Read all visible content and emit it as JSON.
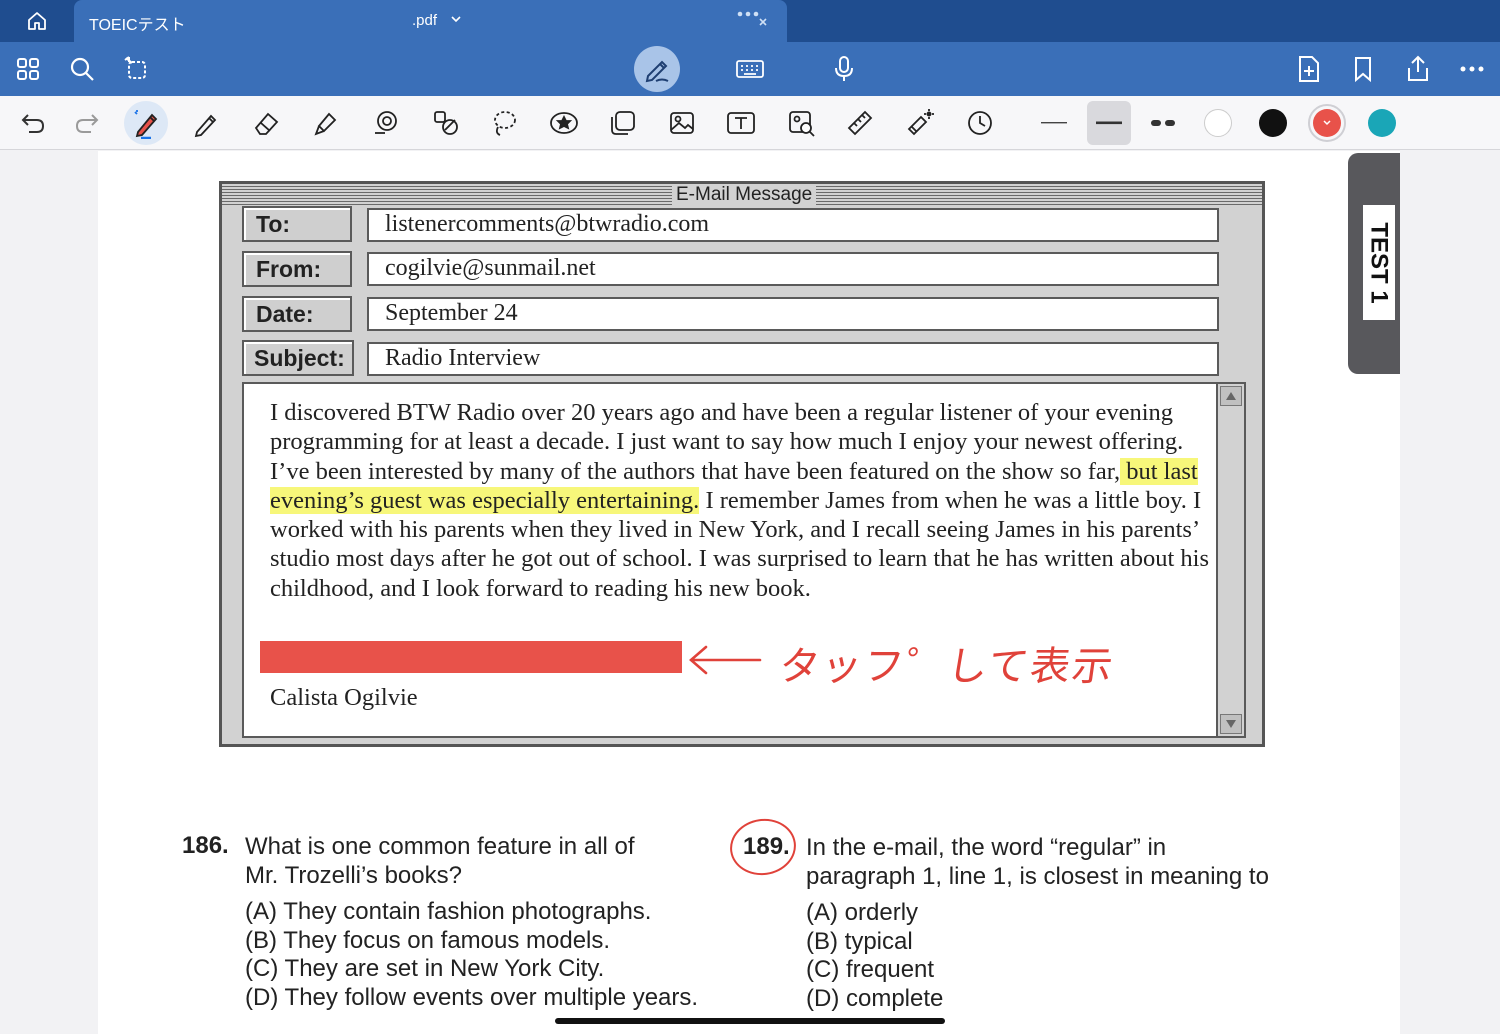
{
  "tabbar": {
    "tab_name": "TOEICテスト",
    "tab_ext": ".pdf"
  },
  "toolbar_colors": {
    "white": "#ffffff",
    "black": "#111111",
    "red": "#e8524a",
    "teal": "#1aa6b7"
  },
  "icons": {
    "home": "home-icon",
    "grid": "grid-icon",
    "search": "search-icon",
    "rotate": "rotate-page-icon",
    "pen_mode": "pen-mode-icon",
    "keyboard": "keyboard-icon",
    "mic": "microphone-icon",
    "add_page": "add-page-icon",
    "bookmark": "bookmark-icon",
    "share": "share-icon",
    "more": "more-icon"
  },
  "page": {
    "side_tab": "TEST 1",
    "email": {
      "window_title": "E-Mail Message",
      "labels": {
        "to": "To:",
        "from": "From:",
        "date": "Date:",
        "subject": "Subject:"
      },
      "values": {
        "to": "listenercomments@btwradio.com",
        "from": "cogilvie@sunmail.net",
        "date": "September 24",
        "subject": "Radio Interview"
      },
      "body_before": "I discovered BTW Radio over 20 years ago and have been a regular listener of your evening programming for at least a decade. I just want to say how much I enjoy your newest offering. I’ve been interested by many of the authors that have been featured on the show so far,",
      "body_highlight": " but last evening’s guest was especially entertaining.",
      "body_after": " I remember James from when he was a little boy. I worked with his parents when they lived in New York, and I recall seeing James in his parents’ studio most days after he got out of school. I was surprised to learn that he has written about his childhood, and I look forward to reading his new book.",
      "signature": "Calista Ogilvie"
    },
    "annotation": "タッフ゜して表示",
    "questions": [
      {
        "number": "186.",
        "text_line1": "What is one common feature in all of",
        "text_line2": "Mr. Trozelli’s books?",
        "options": [
          "(A)  They contain fashion photographs.",
          "(B)  They focus on famous models.",
          "(C)  They are set in New York City.",
          "(D)  They follow events over multiple years."
        ]
      },
      {
        "number": "189.",
        "text_line1": "In the e-mail, the word “regular” in",
        "text_line2": "paragraph 1, line 1, is closest in meaning to",
        "options": [
          "(A)  orderly",
          "(B)  typical",
          "(C)  frequent",
          "(D)  complete"
        ]
      }
    ]
  }
}
